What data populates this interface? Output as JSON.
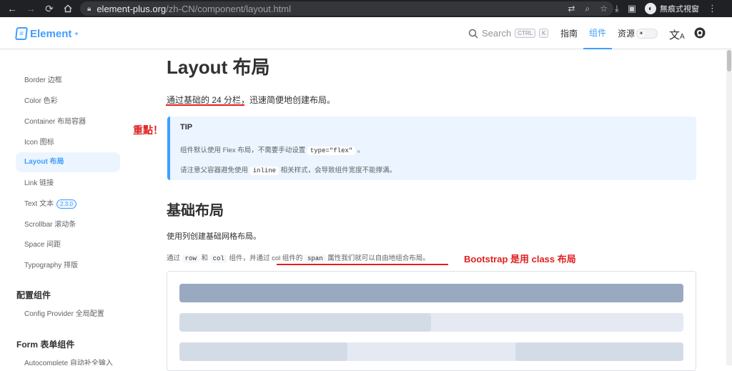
{
  "browser": {
    "url_host": "element-plus.org",
    "url_path": "/zh-CN/component/layout.html",
    "profile_label": "無痕式視窗"
  },
  "header": {
    "logo_text": "Element",
    "logo_sup": "+",
    "search_label": "Search",
    "kbd_ctrl": "CTRL",
    "kbd_k": "K",
    "nav": [
      "指南",
      "组件",
      "资源"
    ],
    "active_nav": "组件"
  },
  "sidebar": {
    "items": [
      "Border 边框",
      "Color 色彩",
      "Container 布局容器",
      "Icon 图标",
      "Layout 布局",
      "Link 链接",
      "Text 文本",
      "Scrollbar 滚动条",
      "Space 间距",
      "Typography 排版"
    ],
    "text_badge": "2.3.0",
    "group_config": "配置组件",
    "config_item": "Config Provider 全局配置",
    "group_form": "Form 表单组件",
    "form_item": "Autocomplete 自动补全输入"
  },
  "main": {
    "title": "Layout 布局",
    "lead_part1": "通过基础的 24 分栏，",
    "lead_part2": "迅速简便地创建布局。",
    "tip": {
      "title": "TIP",
      "line1_a": "组件默认使用 Flex 布局，不需要手动设置 ",
      "line1_code": "type=\"flex\"",
      "line1_b": " 。",
      "line2_a": "请注意父容器避免使用 ",
      "line2_code": "inline",
      "line2_b": " 相关样式，会导致组件宽度不能撑满。"
    },
    "section_title": "基础布局",
    "section_desc": "使用列创建基础网格布局。",
    "p2": {
      "a": "通过 ",
      "code_row": "row",
      "b": " 和 ",
      "code_col": "col",
      "c": " 组件，并通过 col 组件的 ",
      "code_span": "span",
      "d": " 属性我们就可以自由地组合布局。"
    }
  },
  "annotations": {
    "emphasis": "重點！",
    "bootstrap": "Bootstrap 是用 class 布局"
  },
  "colors": {
    "accent": "#409eff",
    "annotation": "#e02020",
    "col_dark": "#99a9bf",
    "col_mid": "#d3dce6",
    "col_light": "#e5e9f2"
  }
}
